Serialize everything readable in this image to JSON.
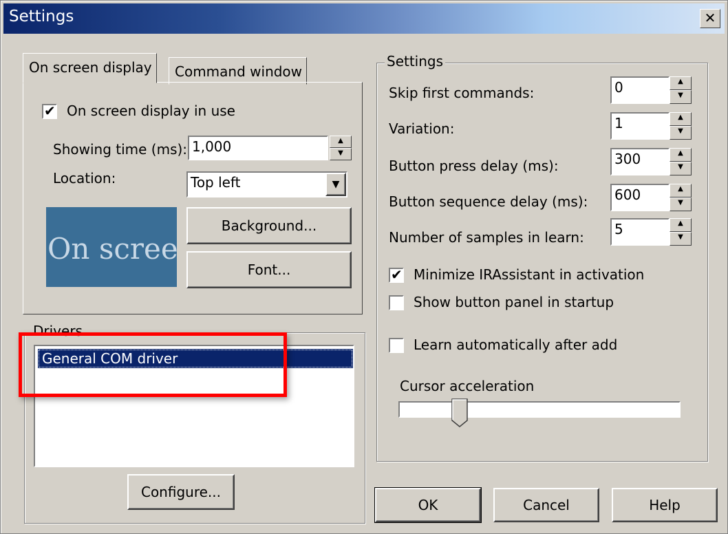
{
  "window": {
    "title": "Settings",
    "close_label": "✕"
  },
  "tabs": {
    "active": "On screen display",
    "inactive": "Command window"
  },
  "osd": {
    "in_use_label": "On screen display in use",
    "in_use_checked": true,
    "showing_time_label": "Showing time (ms):",
    "showing_time_value": "1,000",
    "location_label": "Location:",
    "location_value": "Top left",
    "preview_text": "On screen display",
    "background_button": "Background...",
    "font_button": "Font..."
  },
  "drivers": {
    "group_label": "Drivers",
    "items": [
      "General COM driver"
    ],
    "selected_index": 0,
    "configure_button": "Configure..."
  },
  "settings": {
    "group_label": "Settings",
    "fields": [
      {
        "label": "Skip first commands:",
        "value": "0"
      },
      {
        "label": "Variation:",
        "value": "1"
      },
      {
        "label": "Button press delay (ms):",
        "value": "300"
      },
      {
        "label": "Button sequence delay (ms):",
        "value": "600"
      },
      {
        "label": "Number of samples in learn:",
        "value": "5"
      }
    ],
    "checkboxes": [
      {
        "label": "Minimize IRAssistant in activation",
        "checked": true
      },
      {
        "label": "Show button panel in startup",
        "checked": false
      },
      {
        "label": "Learn automatically after add",
        "checked": false
      }
    ],
    "cursor_acceleration_label": "Cursor acceleration",
    "cursor_acceleration_level": 0.2
  },
  "footer": {
    "ok": "OK",
    "cancel": "Cancel",
    "help": "Help"
  },
  "icons": {
    "checkmark": "✔",
    "spin_up": "▲",
    "spin_down": "▼",
    "dropdown": "▼"
  }
}
